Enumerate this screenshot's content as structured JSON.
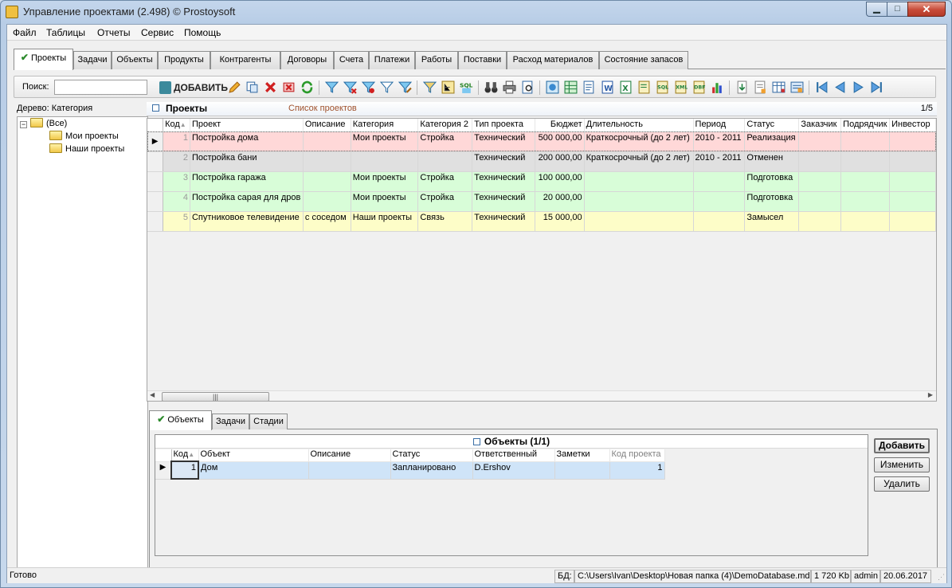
{
  "window": {
    "title": "Управление проектами (2.498) © Prostoysoft"
  },
  "menu": [
    "Файл",
    "Таблицы",
    "Отчеты",
    "Сервис",
    "Помощь"
  ],
  "tabs": [
    "Проекты",
    "Задачи",
    "Объекты",
    "Продукты",
    "Контрагенты",
    "Договоры",
    "Счета",
    "Платежи",
    "Работы",
    "Поставки",
    "Расход материалов",
    "Состояние запасов"
  ],
  "toolbar": {
    "search_label": "Поиск:",
    "search_value": "",
    "add_label": "ДОБАВИТЬ"
  },
  "tree": {
    "label": "Дерево: Категория",
    "root": "(Все)",
    "items": [
      "Мои проекты",
      "Наши проекты"
    ]
  },
  "projects": {
    "title": "Проекты",
    "subtitle": "Список проектов",
    "counter": "1/5",
    "columns": [
      "Код",
      "Проект",
      "Описание",
      "Категория",
      "Категория 2",
      "Тип проекта",
      "Бюджет",
      "Длительность",
      "Период",
      "Статус",
      "Заказчик",
      "Подрядчик",
      "Инвестор"
    ],
    "rows": [
      {
        "id": "1",
        "name": "Постройка дома",
        "desc": "",
        "cat": "Мои проекты",
        "cat2": "Стройка",
        "type": "Технический",
        "budget": "500 000,00",
        "duration": "Краткосрочный (до 2 лет)",
        "period": "2010 - 2011",
        "status": "Реализация",
        "color": "#ffd8d8"
      },
      {
        "id": "2",
        "name": "Постройка бани",
        "desc": "",
        "cat": "",
        "cat2": "",
        "type": "Технический",
        "budget": "200 000,00",
        "duration": "Краткосрочный (до 2 лет)",
        "period": "2010 - 2011",
        "status": "Отменен",
        "color": "#e0e0e0"
      },
      {
        "id": "3",
        "name": "Постройка гаража",
        "desc": "",
        "cat": "Мои проекты",
        "cat2": "Стройка",
        "type": "Технический",
        "budget": "100 000,00",
        "duration": "",
        "period": "",
        "status": "Подготовка",
        "color": "#d8fdd8"
      },
      {
        "id": "4",
        "name": "Постройка сарая для дров",
        "desc": "",
        "cat": "Мои проекты",
        "cat2": "Стройка",
        "type": "Технический",
        "budget": "20 000,00",
        "duration": "",
        "period": "",
        "status": "Подготовка",
        "color": "#d8fdd8"
      },
      {
        "id": "5",
        "name": "Спутниковое телевидение",
        "desc": "с соседом",
        "cat": "Наши проекты",
        "cat2": "Связь",
        "type": "Технический",
        "budget": "15 000,00",
        "duration": "",
        "period": "",
        "status": "Замысел",
        "color": "#fdfdc8"
      }
    ]
  },
  "subtabs": [
    "Объекты",
    "Задачи",
    "Стадии"
  ],
  "objects": {
    "title": "Объекты (1/1)",
    "columns": [
      "Код",
      "Объект",
      "Описание",
      "Статус",
      "Ответственный",
      "Заметки",
      "Код проекта"
    ],
    "rows": [
      {
        "id": "1",
        "name": "Дом",
        "desc": "",
        "status": "Запланировано",
        "owner": "D.Ershov",
        "notes": "",
        "project": "1"
      }
    ],
    "buttons": {
      "add": "Добавить",
      "edit": "Изменить",
      "delete": "Удалить"
    }
  },
  "status": {
    "ready": "Готово",
    "db_label": "БД:",
    "db_path": "C:\\Users\\Ivan\\Desktop\\Новая папка (4)\\DemoDatabase.mdb",
    "size": "1 720 Kb",
    "user": "admin",
    "date": "20.06.2017"
  },
  "colors": {
    "accent": "#2b8a2b",
    "title_bar": "#c4d6ec",
    "selection": "#cfe4f8"
  },
  "icons": [
    "filter-icon",
    "binoculars-icon",
    "print-icon",
    "export-excel-icon",
    "sql-icon",
    "first-record-icon",
    "prev-record-icon",
    "next-record-icon",
    "last-record-icon"
  ]
}
